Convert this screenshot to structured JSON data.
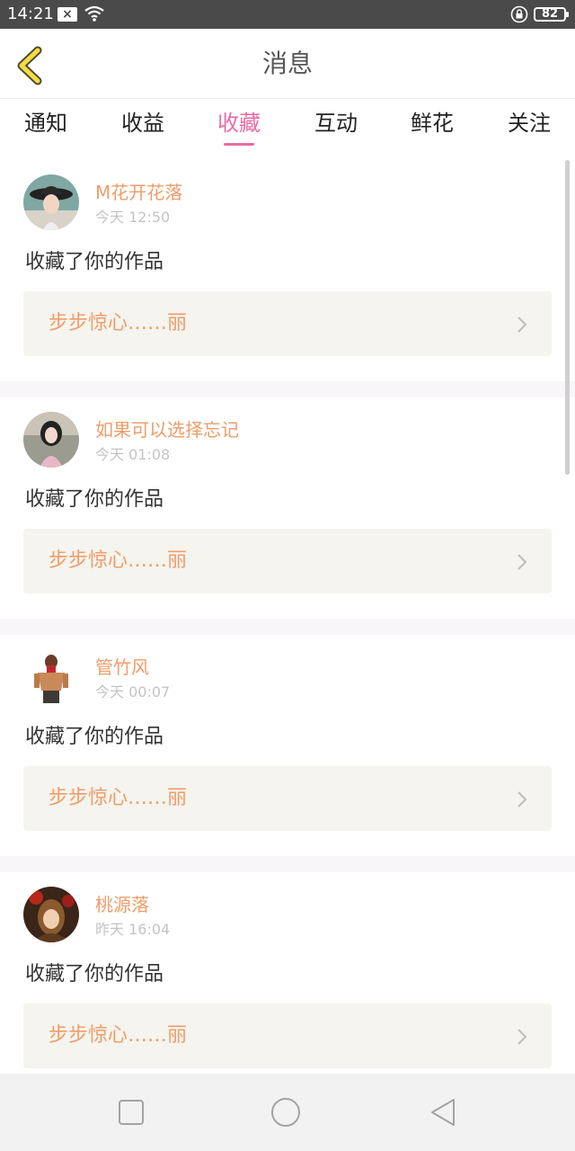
{
  "status_bar": {
    "time": "14:21",
    "battery": "82",
    "icons": [
      "notification-x-icon",
      "wifi-icon",
      "lock-rotation-icon",
      "battery-icon"
    ]
  },
  "header": {
    "title": "消息",
    "back_icon": "chevron-left-icon"
  },
  "tabs": [
    {
      "label": "通知",
      "active": false
    },
    {
      "label": "收益",
      "active": false
    },
    {
      "label": "收藏",
      "active": true
    },
    {
      "label": "互动",
      "active": false
    },
    {
      "label": "鲜花",
      "active": false
    },
    {
      "label": "关注",
      "active": false
    }
  ],
  "colors": {
    "accent_pink": "#ec6aa4",
    "name_orange": "#ef9d6a",
    "work_bg": "#f5f4ee"
  },
  "messages": [
    {
      "user": "M花开花落",
      "time": "今天 12:50",
      "action": "收藏了你的作品",
      "work_title": "步步惊心……丽"
    },
    {
      "user": "如果可以选择忘记",
      "time": "今天 01:08",
      "action": "收藏了你的作品",
      "work_title": "步步惊心……丽"
    },
    {
      "user": "管竹风",
      "time": "今天 00:07",
      "action": "收藏了你的作品",
      "work_title": "步步惊心……丽"
    },
    {
      "user": "桃源落",
      "time": "昨天 16:04",
      "action": "收藏了你的作品",
      "work_title": "步步惊心……丽"
    }
  ],
  "nav_bar": {
    "icons": [
      "recent-apps-square-icon",
      "home-circle-icon",
      "back-triangle-icon"
    ]
  }
}
